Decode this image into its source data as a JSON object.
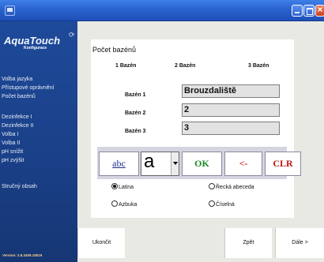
{
  "sidebar": {
    "logo": "AquaTouch",
    "logo_sub": "Konfigurace",
    "items_group1": [
      "Volba jazyka",
      "Přístupové oprávnění",
      "Počet bazénů"
    ],
    "items_group2": [
      "Dezinfekce I",
      "Dezinfekce II",
      "Volba I",
      "Volba II",
      "pH snížit",
      "pH zvýšit"
    ],
    "items_group3": [
      "Stručný obsah"
    ],
    "version": "Version: 2.8.3405.18519"
  },
  "panel": {
    "title": "Počet bazénů",
    "columns": [
      "1 Bazén",
      "2 Bazén",
      "3 Bazén"
    ],
    "rows": [
      {
        "label": "Bazén 1",
        "value": "Brouzdaliště"
      },
      {
        "label": "Bazén 2",
        "value": "2"
      },
      {
        "label": "Bazén 3",
        "value": "3"
      }
    ]
  },
  "keyboard": {
    "abc_label": "abc",
    "char_value": "a",
    "ok_label": "OK",
    "backspace_label": "<-",
    "clear_label": "CLR"
  },
  "charsets": {
    "latin": "Latina",
    "greek": "Řecká abeceda",
    "azbuka": "Azbuka",
    "numeric": "Číselná",
    "selected": "latin"
  },
  "footer": {
    "end_label": "Ukončit",
    "back_label": "Zpět",
    "next_label": "Dále >"
  },
  "colors": {
    "titlebar": "#2a62cf",
    "sidebar": "#1a3f86",
    "ok": "#1c8a2a",
    "clr": "#c01414"
  }
}
